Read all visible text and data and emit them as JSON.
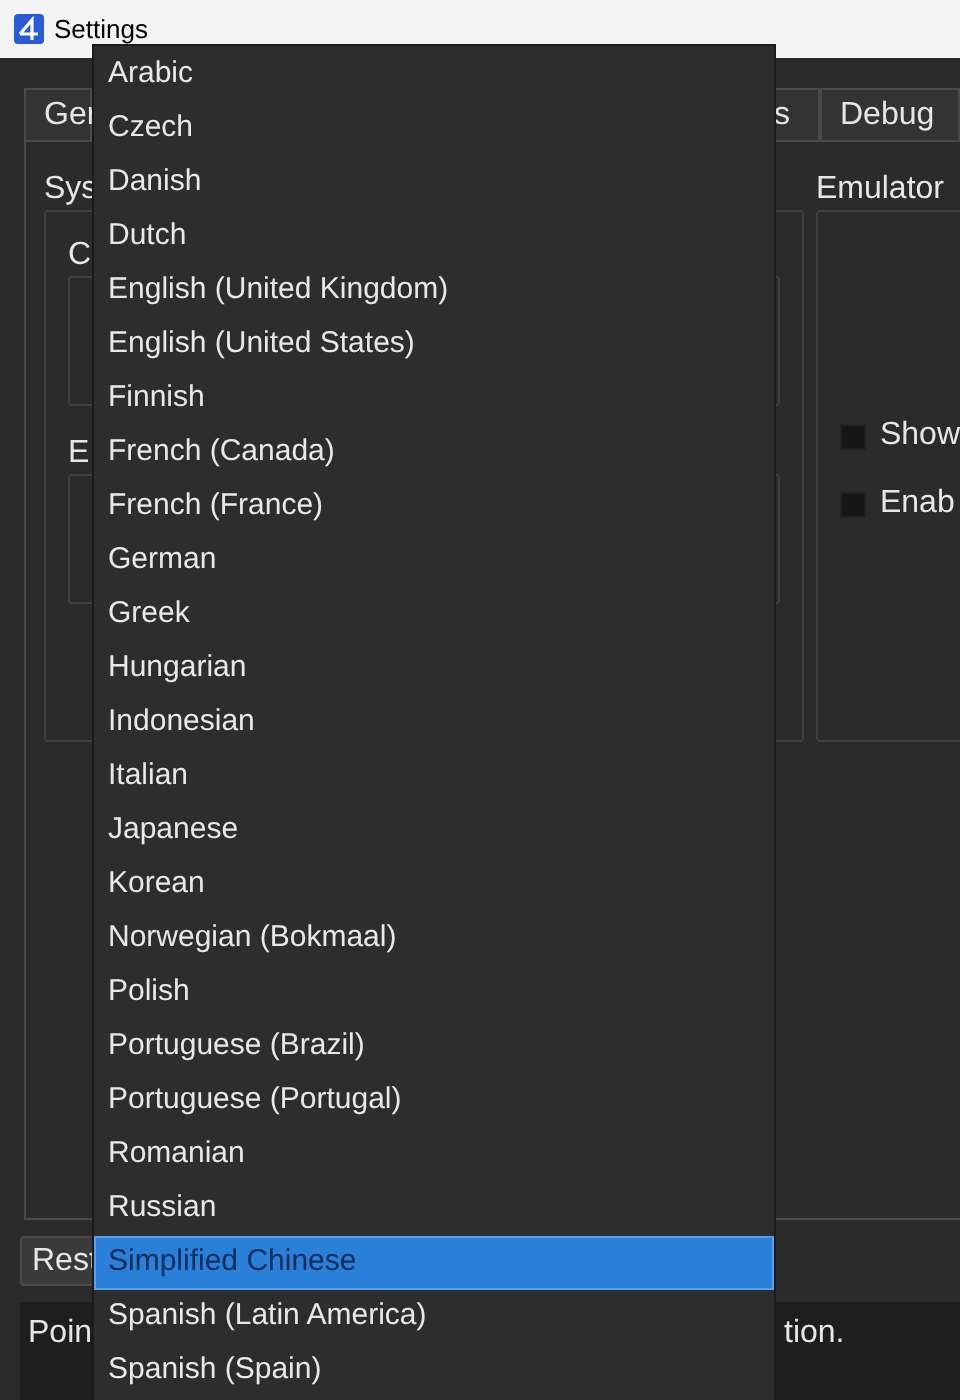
{
  "window": {
    "title": "Settings"
  },
  "tabs": [
    {
      "label": "Ger"
    },
    {
      "label": "s"
    },
    {
      "label": "Debug"
    }
  ],
  "left_group": {
    "title": "Sys",
    "sections": [
      "C",
      "E"
    ]
  },
  "right_group": {
    "title": "Emulator",
    "checkboxes": [
      {
        "label": "Show",
        "checked": false
      },
      {
        "label": "Enab",
        "checked": false
      }
    ]
  },
  "button": "Rest",
  "info": [
    "Poin",
    "tion."
  ],
  "dropdown": {
    "items": [
      {
        "label": "Arabic",
        "selected": false
      },
      {
        "label": "Czech",
        "selected": false
      },
      {
        "label": "Danish",
        "selected": false
      },
      {
        "label": "Dutch",
        "selected": false
      },
      {
        "label": "English (United Kingdom)",
        "selected": false
      },
      {
        "label": "English (United States)",
        "selected": false
      },
      {
        "label": "Finnish",
        "selected": false
      },
      {
        "label": "French (Canada)",
        "selected": false
      },
      {
        "label": "French (France)",
        "selected": false
      },
      {
        "label": "German",
        "selected": false
      },
      {
        "label": "Greek",
        "selected": false
      },
      {
        "label": "Hungarian",
        "selected": false
      },
      {
        "label": "Indonesian",
        "selected": false
      },
      {
        "label": "Italian",
        "selected": false
      },
      {
        "label": "Japanese",
        "selected": false
      },
      {
        "label": "Korean",
        "selected": false
      },
      {
        "label": "Norwegian (Bokmaal)",
        "selected": false
      },
      {
        "label": "Polish",
        "selected": false
      },
      {
        "label": "Portuguese (Brazil)",
        "selected": false
      },
      {
        "label": "Portuguese (Portugal)",
        "selected": false
      },
      {
        "label": "Romanian",
        "selected": false
      },
      {
        "label": "Russian",
        "selected": false
      },
      {
        "label": "Simplified Chinese",
        "selected": true
      },
      {
        "label": "Spanish (Latin America)",
        "selected": false
      },
      {
        "label": "Spanish (Spain)",
        "selected": false
      }
    ]
  }
}
